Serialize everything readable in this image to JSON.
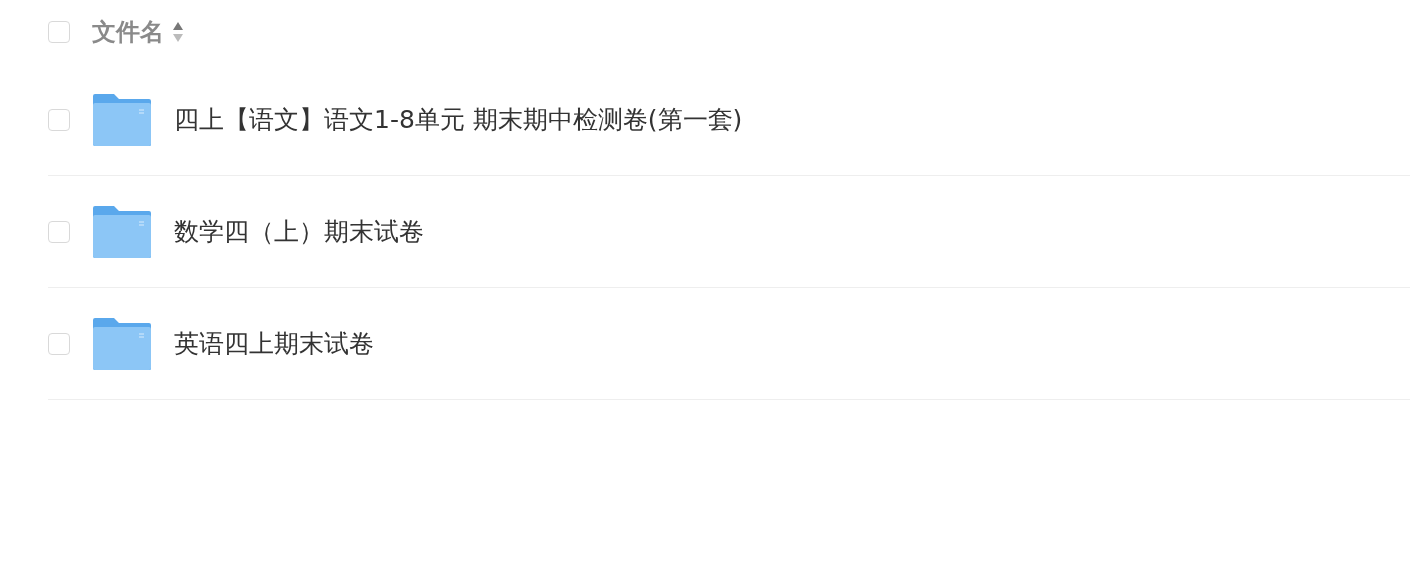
{
  "header": {
    "checked": false,
    "label": "文件名"
  },
  "files": [
    {
      "name": "四上【语文】语文1-8单元 期末期中检测卷(第一套)",
      "checked": false,
      "kind": "folder"
    },
    {
      "name": "数学四（上）期末试卷",
      "checked": false,
      "kind": "folder"
    },
    {
      "name": "英语四上期末试卷",
      "checked": false,
      "kind": "folder"
    }
  ]
}
